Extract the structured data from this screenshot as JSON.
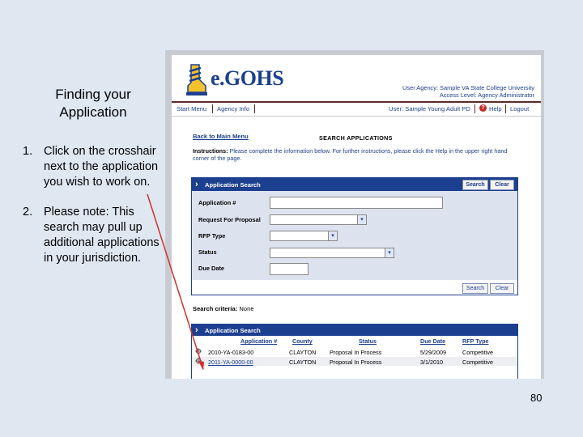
{
  "slide": {
    "title_line1": "Finding your",
    "title_line2": "Application",
    "steps": [
      {
        "num": "1.",
        "text": "Click on the crosshair next to the application you wish to work on."
      },
      {
        "num": "2.",
        "text": "Please note: This search may pull up additional applications in your jurisdiction."
      }
    ],
    "page_number": "80"
  },
  "app": {
    "logo": "e.GOHS",
    "agency_line1": "User Agency: Sample VA State College University",
    "agency_line2": "Access Level: Agency Administrator",
    "nav": {
      "start_menu": "Start Menu",
      "agency_info": "Agency Info",
      "user": "User: Sample Young Adult PD",
      "help": "Help",
      "logout": "Logout"
    },
    "back_link": "Back to Main Menu",
    "page_title": "SEARCH APPLICATIONS",
    "instructions_label": "Instructions:",
    "instructions_text": "Please complete the information below. For further instructions, please click the Help in the upper right hand corner of the page.",
    "search_panel": {
      "title": "Application Search",
      "search_btn": "Search",
      "clear_btn": "Clear",
      "fields": {
        "application_no": "Application #",
        "request_for_proposal": "Request For Proposal",
        "rfp_type": "RFP Type",
        "status": "Status",
        "due_date": "Due Date"
      }
    },
    "criteria_label": "Search criteria:",
    "criteria_value": "None",
    "results": {
      "title": "Application Search",
      "columns": [
        "Application #",
        "County",
        "Status",
        "Due Date",
        "RFP Type"
      ],
      "rows": [
        [
          "2010-YA-0183-00",
          "CLAYTON",
          "Proposal In Process",
          "5/29/2009",
          "Competitive"
        ],
        [
          "2011-YA-0000-00",
          "CLAYTON",
          "Proposal In Process",
          "3/1/2010",
          "Competitive"
        ]
      ]
    }
  },
  "colors": {
    "accent": "#1c3f8f",
    "arrow": "#d32f2f",
    "slide_bg": "#dfe7f1"
  }
}
